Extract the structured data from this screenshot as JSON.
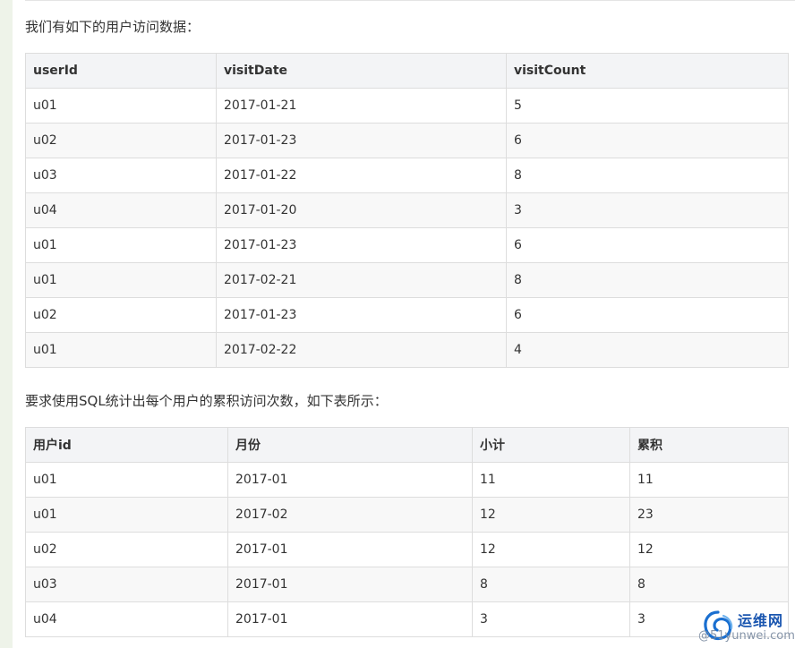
{
  "intro_text": "我们有如下的用户访问数据：",
  "visits_table": {
    "headers": [
      "userId",
      "visitDate",
      "visitCount"
    ],
    "rows": [
      [
        "u01",
        "2017-01-21",
        "5"
      ],
      [
        "u02",
        "2017-01-23",
        "6"
      ],
      [
        "u03",
        "2017-01-22",
        "8"
      ],
      [
        "u04",
        "2017-01-20",
        "3"
      ],
      [
        "u01",
        "2017-01-23",
        "6"
      ],
      [
        "u01",
        "2017-02-21",
        "8"
      ],
      [
        "u02",
        "2017-01-23",
        "6"
      ],
      [
        "u01",
        "2017-02-22",
        "4"
      ]
    ]
  },
  "requirement_text": "要求使用SQL统计出每个用户的累积访问次数，如下表所示：",
  "result_table": {
    "headers": [
      "用户id",
      "月份",
      "小计",
      "累积"
    ],
    "rows": [
      [
        "u01",
        "2017-01",
        "11",
        "11"
      ],
      [
        "u01",
        "2017-02",
        "12",
        "23"
      ],
      [
        "u02",
        "2017-01",
        "12",
        "12"
      ],
      [
        "u03",
        "2017-01",
        "8",
        "8"
      ],
      [
        "u04",
        "2017-01",
        "3",
        "3"
      ]
    ]
  },
  "watermark": {
    "brand_cn": "运维网",
    "brand_en": "@51yunwei.com",
    "color": "#1a56b0"
  }
}
